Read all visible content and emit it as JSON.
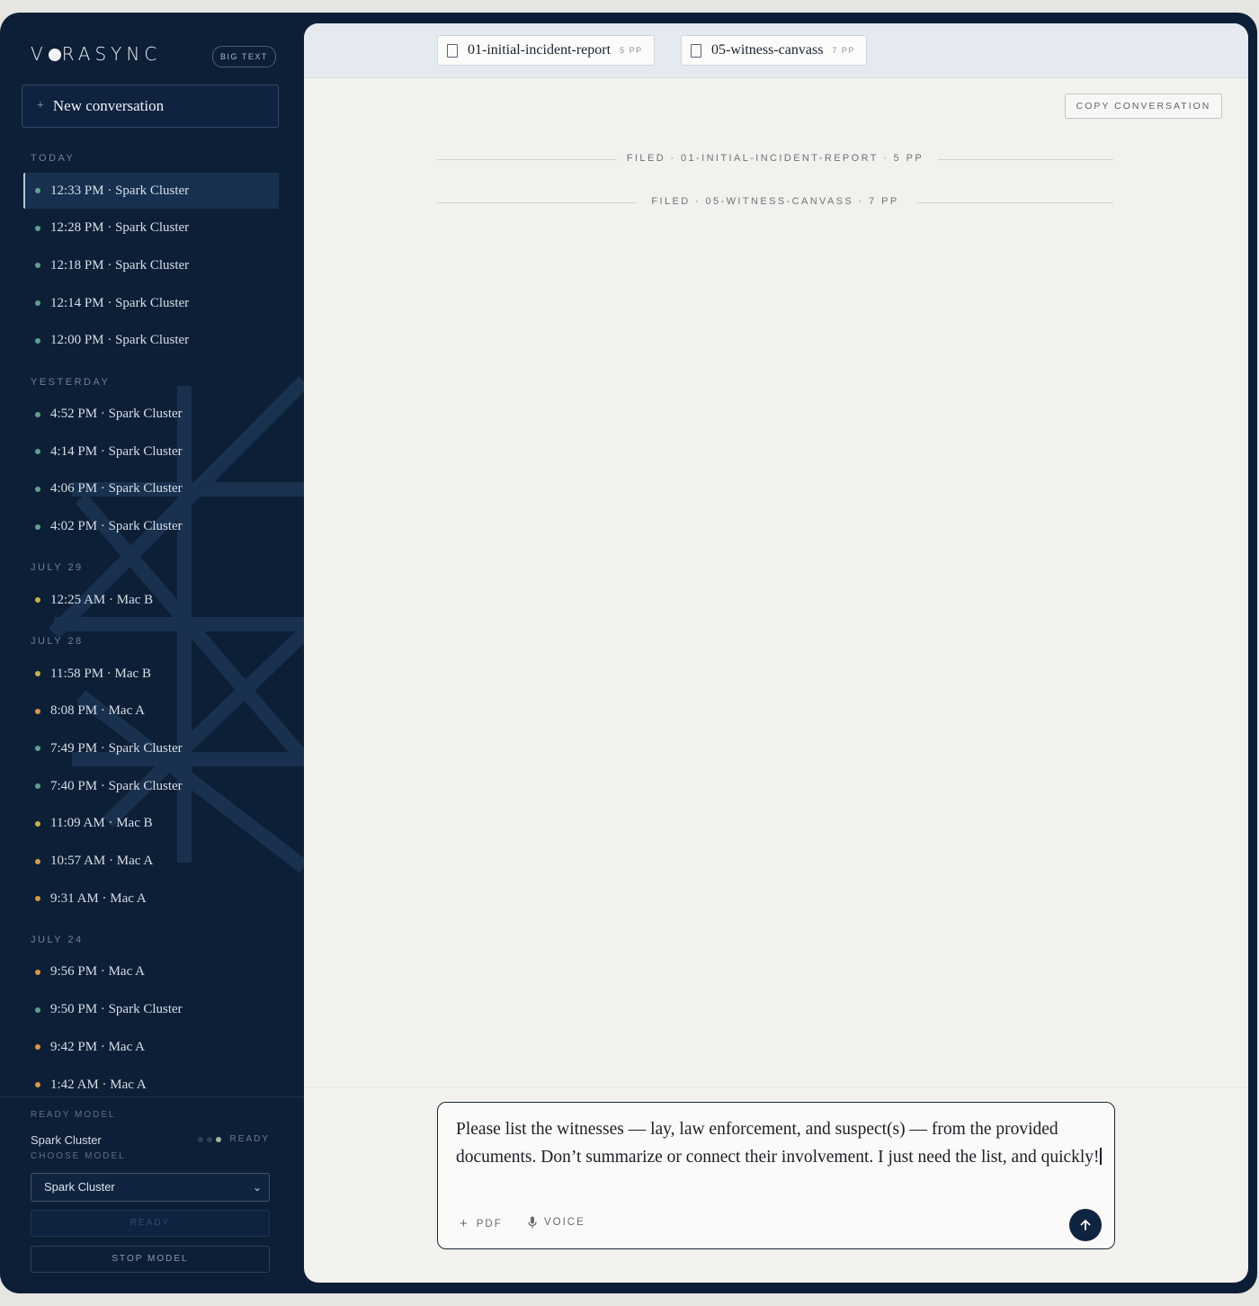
{
  "app": {
    "logo": "VORASYNC",
    "big_text_label": "BIG TEXT",
    "new_conversation_label": "New conversation"
  },
  "history": {
    "groups": [
      {
        "label": "TODAY",
        "items": [
          {
            "label": "12:33 PM · Spark Cluster",
            "model": "Spark Cluster",
            "active": true
          },
          {
            "label": "12:28 PM · Spark Cluster",
            "model": "Spark Cluster"
          },
          {
            "label": "12:18 PM · Spark Cluster",
            "model": "Spark Cluster"
          },
          {
            "label": "12:14 PM · Spark Cluster",
            "model": "Spark Cluster"
          },
          {
            "label": "12:00 PM · Spark Cluster",
            "model": "Spark Cluster"
          }
        ]
      },
      {
        "label": "YESTERDAY",
        "items": [
          {
            "label": "4:52 PM · Spark Cluster",
            "model": "Spark Cluster"
          },
          {
            "label": "4:14 PM · Spark Cluster",
            "model": "Spark Cluster"
          },
          {
            "label": "4:06 PM · Spark Cluster",
            "model": "Spark Cluster"
          },
          {
            "label": "4:02 PM · Spark Cluster",
            "model": "Spark Cluster"
          }
        ]
      },
      {
        "label": "JULY 29",
        "items": [
          {
            "label": "12:25 AM · Mac B",
            "model": "Mac B"
          }
        ]
      },
      {
        "label": "JULY 28",
        "items": [
          {
            "label": "11:58 PM · Mac B",
            "model": "Mac B"
          },
          {
            "label": "8:08 PM · Mac A",
            "model": "Mac A"
          },
          {
            "label": "7:49 PM · Spark Cluster",
            "model": "Spark Cluster"
          },
          {
            "label": "7:40 PM · Spark Cluster",
            "model": "Spark Cluster"
          },
          {
            "label": "11:09 AM · Mac B",
            "model": "Mac B"
          },
          {
            "label": "10:57 AM · Mac A",
            "model": "Mac A"
          },
          {
            "label": "9:31 AM · Mac A",
            "model": "Mac A"
          }
        ]
      },
      {
        "label": "JULY 24",
        "items": [
          {
            "label": "9:56 PM · Mac A",
            "model": "Mac A"
          },
          {
            "label": "9:50 PM · Spark Cluster",
            "model": "Spark Cluster"
          },
          {
            "label": "9:42 PM · Mac A",
            "model": "Mac A"
          },
          {
            "label": "1:42 AM · Mac A",
            "model": "Mac A"
          }
        ]
      }
    ]
  },
  "model_colors": {
    "Spark Cluster": "#5fa08e",
    "Mac A": "#d39a4a",
    "Mac B": "#c7b14a"
  },
  "footer": {
    "ready_model_label": "READY MODEL",
    "ready_model_name": "Spark Cluster",
    "status": "READY",
    "choose_model_label": "CHOOSE MODEL",
    "selected_model": "Spark Cluster",
    "ready_button": "READY",
    "stop_button": "STOP MODEL"
  },
  "tabs": [
    {
      "name": "01-initial-incident-report",
      "pages": "5 PP"
    },
    {
      "name": "05-witness-canvass",
      "pages": "7 PP"
    }
  ],
  "main": {
    "copy_label": "COPY CONVERSATION",
    "filed": [
      "FILED · 01-INITIAL-INCIDENT-REPORT · 5 PP",
      "FILED · 05-WITNESS-CANVASS · 7 PP"
    ]
  },
  "composer": {
    "text": "Please list the witnesses — lay, law enforcement, and suspect(s) — from the provided documents. Don’t summarize or connect their involvement. I just need the list, and quickly!",
    "pdf_label": "PDF",
    "voice_label": "VOICE"
  },
  "colors": {
    "navy": "#0d1f36",
    "panel": "#f2f1ee",
    "accent_send": "#0f2440"
  }
}
